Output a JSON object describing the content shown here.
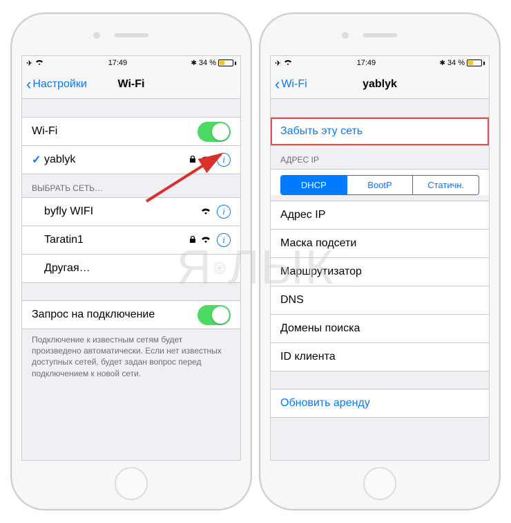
{
  "left": {
    "status": {
      "time": "17:49",
      "battery": "34 %",
      "airplane": "✈︎",
      "bt": "✱"
    },
    "nav": {
      "back": "Настройки",
      "title": "Wi-Fi"
    },
    "wifiRow": {
      "label": "Wi-Fi"
    },
    "connected": {
      "name": "yablyk"
    },
    "groupSelect": "ВЫБРАТЬ СЕТЬ…",
    "networks": [
      {
        "name": "byfly WIFI",
        "lock": false
      },
      {
        "name": "Taratin1",
        "lock": true
      }
    ],
    "other": "Другая…",
    "askRow": {
      "label": "Запрос на подключение"
    },
    "footer": "Подключение к известным сетям будет произведено автоматически. Если нет известных доступных сетей, будет задан вопрос перед подключением к новой сети."
  },
  "right": {
    "status": {
      "time": "17:49",
      "battery": "34 %",
      "airplane": "✈︎",
      "bt": "✱"
    },
    "nav": {
      "back": "Wi-Fi",
      "title": "yablyk"
    },
    "forget": "Забыть эту сеть",
    "groupIp": "АДРЕС IP",
    "seg": {
      "dhcp": "DHCP",
      "bootp": "BootP",
      "static": "Статичн."
    },
    "fields": [
      "Адрес IP",
      "Маска подсети",
      "Маршрутизатор",
      "DNS",
      "Домены поиска",
      "ID клиента"
    ],
    "renew": "Обновить аренду"
  },
  "watermark": "ЯБЛЫК"
}
